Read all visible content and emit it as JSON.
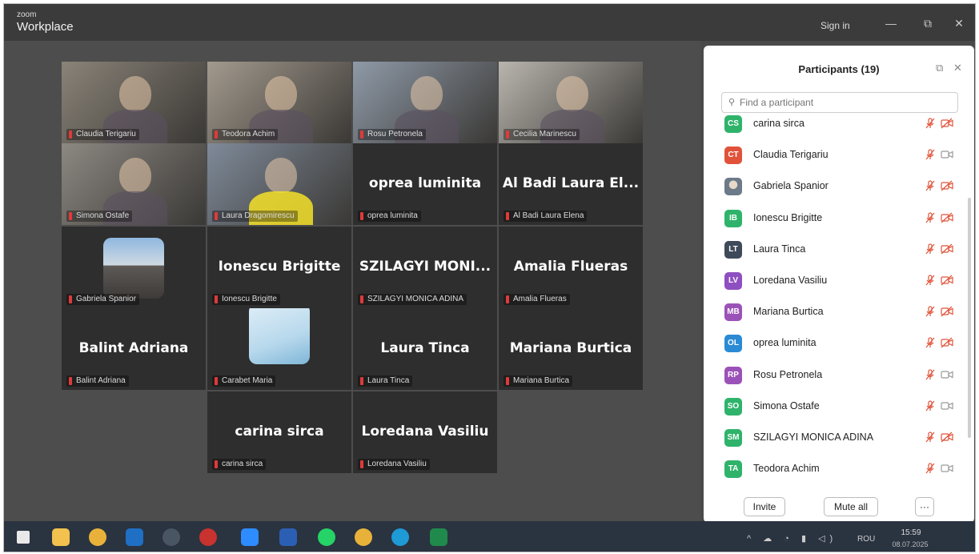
{
  "titlebar": {
    "brand_small": "zoom",
    "brand_big": "Workplace",
    "sign_in": "Sign in",
    "minimize_glyph": "—",
    "restore_glyph": "⧉",
    "close_glyph": "✕"
  },
  "gallery": {
    "tiles": [
      {
        "label": "Claudia Terigariu",
        "big": "",
        "kind": "camera",
        "cam_color": "#8a8378"
      },
      {
        "label": "Teodora Achim",
        "big": "",
        "kind": "camera",
        "cam_color": "#a39a8e"
      },
      {
        "label": "Rosu Petronela",
        "big": "",
        "kind": "camera",
        "cam_color": "#8f9aa8"
      },
      {
        "label": "Cecilia Marinescu",
        "big": "",
        "kind": "camera",
        "cam_color": "#b9b5ae"
      },
      {
        "label": "Simona Ostafe",
        "big": "",
        "kind": "camera",
        "cam_color": "#8c8882"
      },
      {
        "label": "Laura Dragomirescu",
        "big": "",
        "kind": "camera",
        "cam_color": "#7f8a99"
      },
      {
        "label": "oprea luminita",
        "big": "oprea luminita",
        "kind": "name"
      },
      {
        "label": "Al Badi Laura Elena",
        "big": "Al Badi Laura El...",
        "kind": "name"
      },
      {
        "label": "Gabriela Spanior",
        "big": "",
        "kind": "avatar"
      },
      {
        "label": "Ionescu Brigitte",
        "big": "Ionescu Brigitte",
        "kind": "name"
      },
      {
        "label": "SZILAGYI MONICA ADINA",
        "big": "SZILAGYI MONI...",
        "kind": "name"
      },
      {
        "label": "Amalia Flueras",
        "big": "Amalia Flueras",
        "kind": "name"
      },
      {
        "label": "Balint Adriana",
        "big": "Balint Adriana",
        "kind": "name"
      },
      {
        "label": "Carabet Maria",
        "big": "",
        "kind": "avatar2"
      },
      {
        "label": "Laura Tinca",
        "big": "Laura Tinca",
        "kind": "name"
      },
      {
        "label": "Mariana Burtica",
        "big": "Mariana Burtica",
        "kind": "name"
      },
      {
        "label": "carina sirca",
        "big": "carina sirca",
        "kind": "name"
      },
      {
        "label": "Loredana Vasiliu",
        "big": "Loredana Vasiliu",
        "kind": "name"
      }
    ]
  },
  "panel": {
    "title": "Participants (19)",
    "search_placeholder": "Find a participant",
    "participants": [
      {
        "initials": "CS",
        "name": "carina sirca",
        "color": "#2fb36b",
        "video": "off"
      },
      {
        "initials": "CT",
        "name": "Claudia Terigariu",
        "color": "#e0533a",
        "video": "on"
      },
      {
        "initials": "",
        "name": "Gabriela Spanior",
        "color": "#6c7a8a",
        "video": "off"
      },
      {
        "initials": "IB",
        "name": "Ionescu Brigitte",
        "color": "#2fb36b",
        "video": "off"
      },
      {
        "initials": "LT",
        "name": "Laura Tinca",
        "color": "#3e4a5a",
        "video": "off"
      },
      {
        "initials": "LV",
        "name": "Loredana Vasiliu",
        "color": "#8e4fc0",
        "video": "off"
      },
      {
        "initials": "MB",
        "name": "Mariana Burtica",
        "color": "#9b52b8",
        "video": "off"
      },
      {
        "initials": "OL",
        "name": "oprea luminita",
        "color": "#2b8ad4",
        "video": "off"
      },
      {
        "initials": "RP",
        "name": "Rosu Petronela",
        "color": "#9b52b8",
        "video": "on"
      },
      {
        "initials": "SO",
        "name": "Simona Ostafe",
        "color": "#2fb36b",
        "video": "on"
      },
      {
        "initials": "SM",
        "name": "SZILAGYI MONICA ADINA",
        "color": "#2fb36b",
        "video": "off"
      },
      {
        "initials": "TA",
        "name": "Teodora Achim",
        "color": "#2fb36b",
        "video": "on"
      }
    ],
    "invite_label": "Invite",
    "mute_all_label": "Mute all",
    "more_label": "···"
  },
  "taskbar": {
    "lang": "ROU",
    "time": "15:59",
    "date": "08.07.2025",
    "apps": [
      {
        "name": "windows-start-icon",
        "color": "#e9e9e9"
      },
      {
        "name": "file-explorer-icon",
        "color": "#f2c14e"
      },
      {
        "name": "chrome-icon",
        "color": "#e8b23a"
      },
      {
        "name": "outlook-icon",
        "color": "#1f6fc4"
      },
      {
        "name": "app-c-icon",
        "color": "#4a5563"
      },
      {
        "name": "antivirus-icon",
        "color": "#c8322f"
      },
      {
        "name": "zoom-icon",
        "color": "#2d8cff"
      },
      {
        "name": "word-icon",
        "color": "#2b5fb4"
      },
      {
        "name": "whatsapp-icon",
        "color": "#25d366"
      },
      {
        "name": "chrome-2-icon",
        "color": "#e8b23a"
      },
      {
        "name": "edge-icon",
        "color": "#1e9ad6"
      },
      {
        "name": "excel-icon",
        "color": "#1f8a4c"
      }
    ]
  }
}
